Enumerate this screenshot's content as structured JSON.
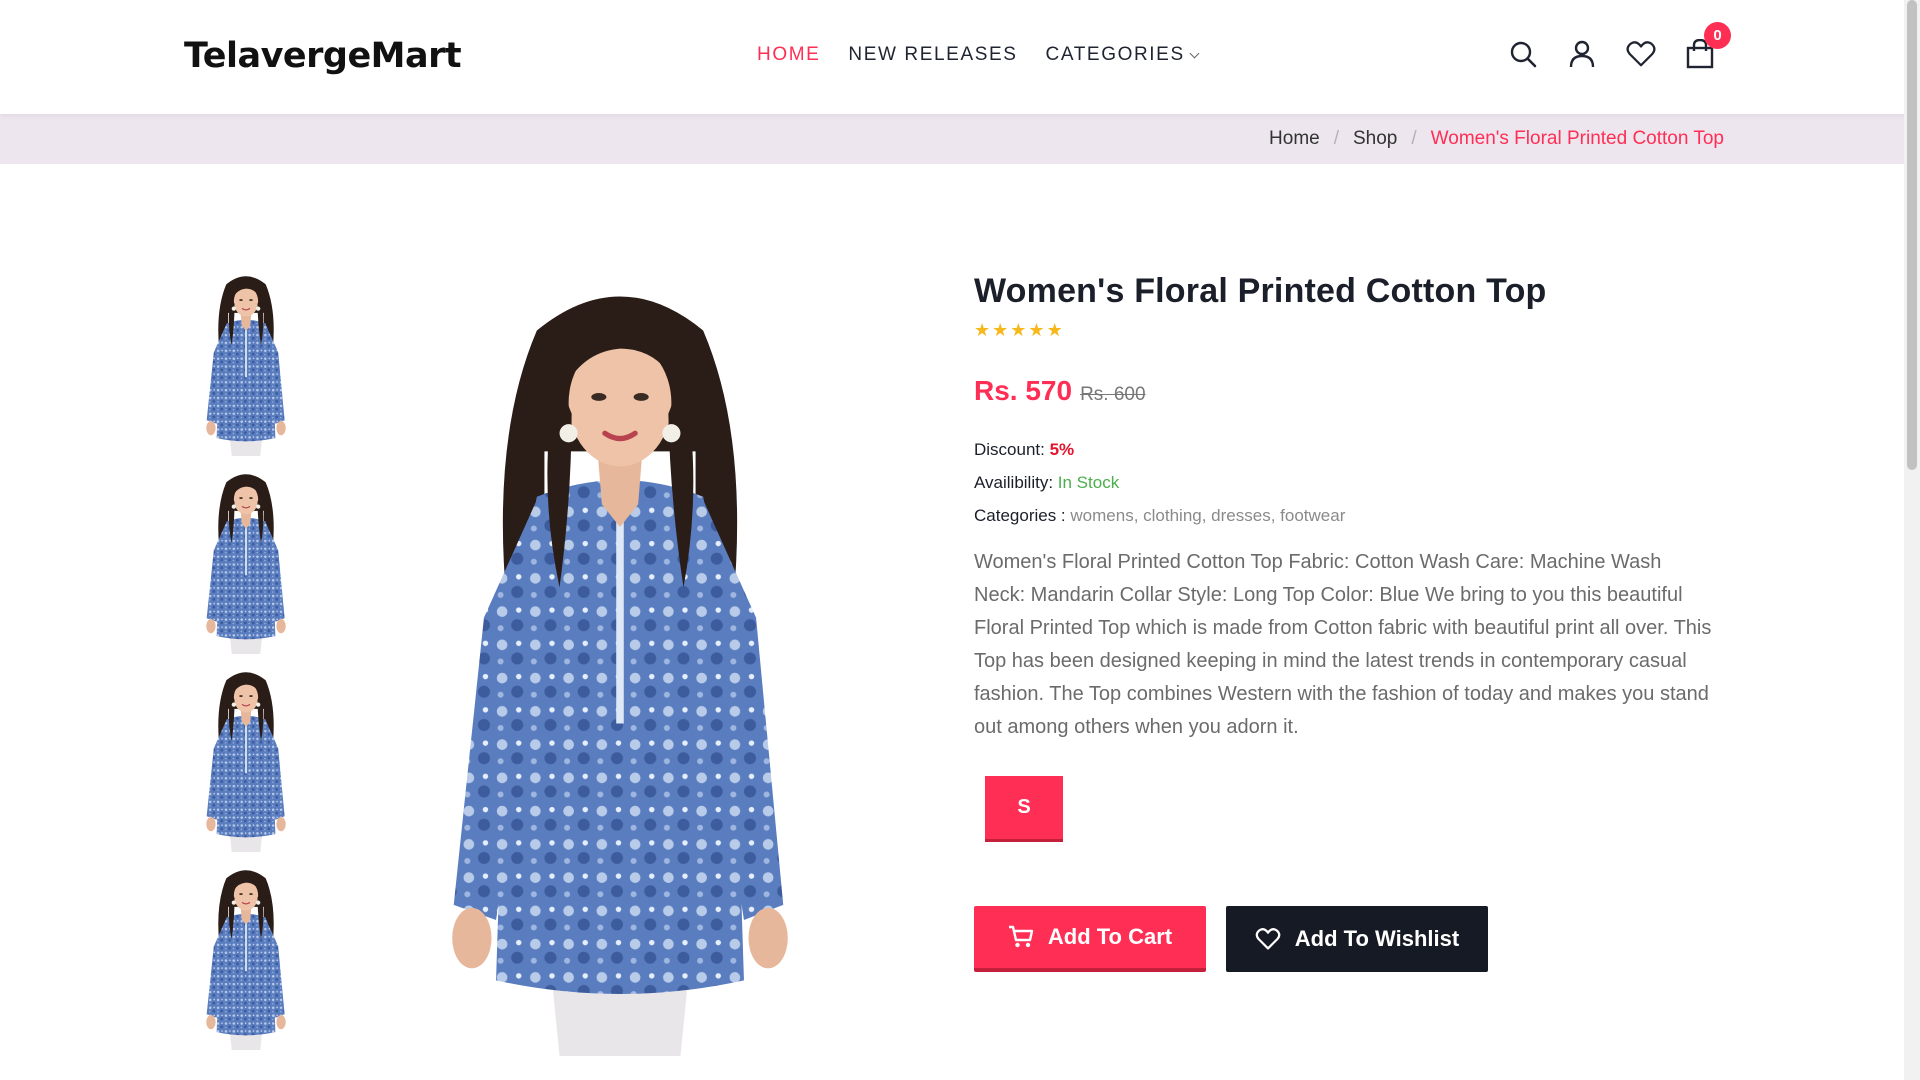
{
  "brand": {
    "logo_text": "TelavergeMart"
  },
  "nav": {
    "items": [
      {
        "label": "HOME",
        "active": true
      },
      {
        "label": "NEW RELEASES",
        "active": false
      },
      {
        "label": "CATEGORIES",
        "active": false,
        "has_dropdown": true
      }
    ]
  },
  "header_icons": {
    "search": "search-icon",
    "account": "user-icon",
    "wishlist": "heart-icon",
    "cart": "shopping-bag-icon",
    "cart_count": "0"
  },
  "breadcrumb": {
    "items": [
      "Home",
      "Shop"
    ],
    "separator": "/",
    "current": "Women's Floral Printed Cotton Top"
  },
  "product": {
    "title": "Women's Floral Printed Cotton Top",
    "rating_stars": 5,
    "price": "Rs. 570",
    "old_price": "Rs. 600",
    "discount_label": "Discount: ",
    "discount_value": "5%",
    "availability_label": "Availibility: ",
    "availability_value": "In Stock",
    "categories_label": "Categories : ",
    "categories_value": "womens, clothing, dresses, footwear",
    "description": "Women's Floral Printed Cotton Top Fabric: Cotton Wash Care: Machine Wash Neck: Mandarin Collar Style: Long Top Color: Blue We bring to you this beautiful Floral Printed Top which is made from Cotton fabric with beautiful print all over. This Top has been designed keeping in mind the latest trends in contemporary casual fashion. The Top combines Western with the fashion of today and makes you stand out among others when you adorn it.",
    "sizes": [
      "S"
    ],
    "selected_size": "S",
    "thumbnail_count": 4
  },
  "actions": {
    "add_to_cart": "Add To Cart",
    "add_to_wishlist": "Add To Wishlist"
  },
  "colors": {
    "accent": "#ff2e55",
    "dark_button": "#161a24",
    "in_stock": "#4cae4c",
    "star": "#f6b81a",
    "breadcrumb_band": "#ede6ee",
    "shirt_blue": "#5b7fc0"
  }
}
